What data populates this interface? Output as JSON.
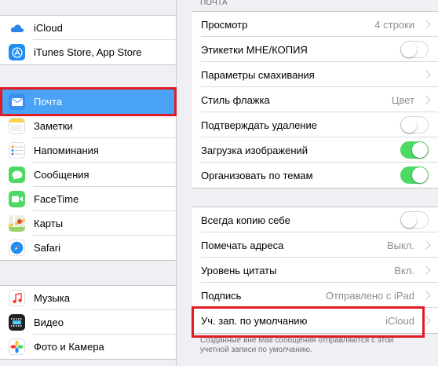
{
  "sidebar": {
    "group1": [
      {
        "label": "iCloud",
        "icon": "cloud-icon",
        "color": "#ffffff"
      },
      {
        "label": "iTunes Store, App Store",
        "icon": "app-store-icon",
        "color": "#1e8ef0"
      }
    ],
    "group2": [
      {
        "label": "Почта",
        "icon": "mail-icon",
        "color": "#3b8df1",
        "selected": true
      },
      {
        "label": "Заметки",
        "icon": "notes-icon",
        "color": "#f7d448"
      },
      {
        "label": "Напоминания",
        "icon": "reminders-icon",
        "color": "#ffffff"
      },
      {
        "label": "Сообщения",
        "icon": "messages-icon",
        "color": "#4cd964"
      },
      {
        "label": "FaceTime",
        "icon": "facetime-icon",
        "color": "#4cd964"
      },
      {
        "label": "Карты",
        "icon": "maps-icon",
        "color": "#9bd36b"
      },
      {
        "label": "Safari",
        "icon": "safari-icon",
        "color": "#1e8ef0"
      }
    ],
    "group3": [
      {
        "label": "Музыка",
        "icon": "music-icon",
        "color": "#ffffff"
      },
      {
        "label": "Видео",
        "icon": "video-icon",
        "color": "#222222"
      },
      {
        "label": "Фото и Камера",
        "icon": "photos-icon",
        "color": "#ffffff"
      }
    ]
  },
  "panel": {
    "section_title": "ПОЧТА",
    "group1": [
      {
        "label": "Просмотр",
        "value": "4 строки",
        "chevron": true
      },
      {
        "label": "Этикетки МНЕ/КОПИЯ",
        "toggle": false
      },
      {
        "label": "Параметры смахивания",
        "value": "",
        "chevron": true
      },
      {
        "label": "Стиль флажка",
        "value": "Цвет",
        "chevron": true
      },
      {
        "label": "Подтверждать удаление",
        "toggle": false
      },
      {
        "label": "Загрузка изображений",
        "toggle": true
      },
      {
        "label": "Организовать по темам",
        "toggle": true
      }
    ],
    "group2": [
      {
        "label": "Всегда копию себе",
        "toggle": false
      },
      {
        "label": "Помечать адреса",
        "value": "Выкл.",
        "chevron": true
      },
      {
        "label": "Уровень цитаты",
        "value": "Вкл.",
        "chevron": true
      },
      {
        "label": "Подпись",
        "value": "Отправлено с iPad",
        "chevron": true
      },
      {
        "label": "Уч. зап. по умолчанию",
        "value": "iCloud",
        "chevron": true
      }
    ],
    "footer_note": "Созданные вне Mail сообщения отправляются с этой учетной записи по умолчанию."
  },
  "colors": {
    "highlight": "#e01b24",
    "accent": "#4aa2f5",
    "toggle_on": "#4cd964"
  }
}
